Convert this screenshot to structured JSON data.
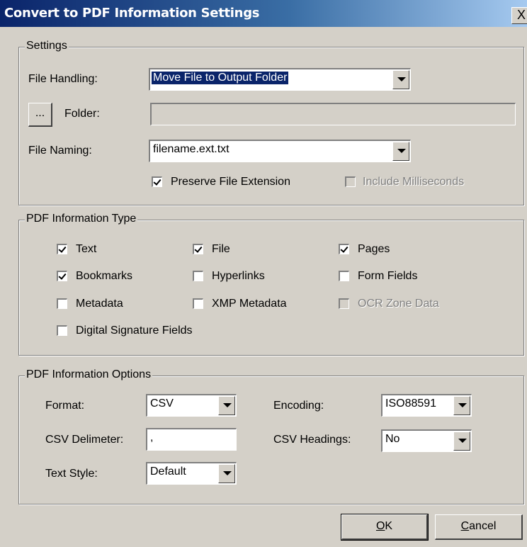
{
  "window": {
    "title": "Convert to PDF Information Settings",
    "close_label": "X"
  },
  "settings": {
    "legend": "Settings",
    "file_handling_label": "File Handling:",
    "file_handling_value": "Move File to Output Folder",
    "folder_button_label": "...",
    "folder_label": "Folder:",
    "folder_value": "",
    "file_naming_label": "File Naming:",
    "file_naming_value": "filename.ext.txt",
    "preserve_ext_label": "Preserve File Extension",
    "preserve_ext_checked": true,
    "include_ms_label": "Include Milliseconds",
    "include_ms_checked": false,
    "include_ms_enabled": false
  },
  "info_type": {
    "legend": "PDF Information Type",
    "items": [
      {
        "label": "Text",
        "checked": true,
        "enabled": true
      },
      {
        "label": "File",
        "checked": true,
        "enabled": true
      },
      {
        "label": "Pages",
        "checked": true,
        "enabled": true
      },
      {
        "label": "Bookmarks",
        "checked": true,
        "enabled": true
      },
      {
        "label": "Hyperlinks",
        "checked": false,
        "enabled": true
      },
      {
        "label": "Form Fields",
        "checked": false,
        "enabled": true
      },
      {
        "label": "Metadata",
        "checked": false,
        "enabled": true
      },
      {
        "label": "XMP Metadata",
        "checked": false,
        "enabled": true
      },
      {
        "label": "OCR Zone Data",
        "checked": false,
        "enabled": false
      },
      {
        "label": "Digital Signature Fields",
        "checked": false,
        "enabled": true
      }
    ]
  },
  "options": {
    "legend": "PDF Information Options",
    "format_label": "Format:",
    "format_value": "CSV",
    "encoding_label": "Encoding:",
    "encoding_value": "ISO88591",
    "delimiter_label": "CSV Delimeter:",
    "delimiter_value": ",",
    "headings_label": "CSV Headings:",
    "headings_value": "No",
    "text_style_label": "Text Style:",
    "text_style_value": "Default"
  },
  "buttons": {
    "ok": "OK",
    "cancel": "Cancel"
  }
}
